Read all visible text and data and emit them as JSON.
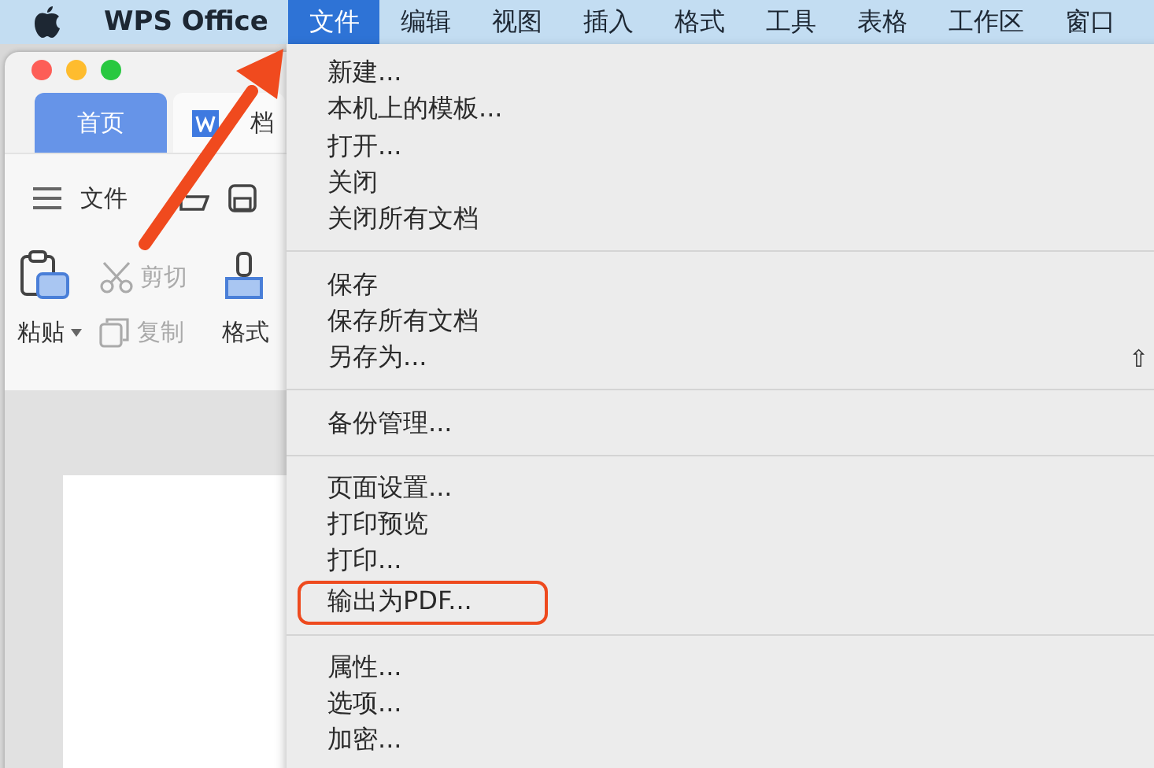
{
  "menu_bar": {
    "app_name": "WPS Office",
    "menus": [
      {
        "label": "文件",
        "selected": true
      },
      {
        "label": "编辑",
        "selected": false
      },
      {
        "label": "视图",
        "selected": false
      },
      {
        "label": "插入",
        "selected": false
      },
      {
        "label": "格式",
        "selected": false
      },
      {
        "label": "工具",
        "selected": false
      },
      {
        "label": "表格",
        "selected": false
      },
      {
        "label": "工作区",
        "selected": false
      },
      {
        "label": "窗口",
        "selected": false
      }
    ]
  },
  "window": {
    "tabs": [
      {
        "label": "首页",
        "kind": "home",
        "selected": true
      },
      {
        "label": "档",
        "kind": "document",
        "selected": false
      }
    ],
    "toolbar_menu": "文件",
    "ribbon": [
      {
        "label": "粘贴",
        "kind": "paste",
        "disabled": false
      },
      {
        "label": "剪切",
        "kind": "cut",
        "disabled": true
      },
      {
        "label": "复制",
        "kind": "copy",
        "disabled": true
      },
      {
        "label": "格式",
        "kind": "format",
        "disabled": false
      }
    ]
  },
  "file_menu": {
    "items": [
      {
        "kind": "item",
        "label": "新建...",
        "highlighted": false
      },
      {
        "kind": "item",
        "label": "本机上的模板...",
        "highlighted": false
      },
      {
        "kind": "item",
        "label": "打开...",
        "highlighted": false
      },
      {
        "kind": "item",
        "label": "关闭",
        "highlighted": false
      },
      {
        "kind": "item",
        "label": "关闭所有文档",
        "highlighted": false
      },
      {
        "kind": "separator"
      },
      {
        "kind": "item",
        "label": "保存",
        "highlighted": false
      },
      {
        "kind": "item",
        "label": "保存所有文档",
        "highlighted": false
      },
      {
        "kind": "item",
        "label": "另存为...",
        "shortcut": "⇧",
        "highlighted": false
      },
      {
        "kind": "separator"
      },
      {
        "kind": "item",
        "label": "备份管理...",
        "highlighted": false
      },
      {
        "kind": "separator"
      },
      {
        "kind": "item",
        "label": "页面设置...",
        "highlighted": false
      },
      {
        "kind": "item",
        "label": "打印预览",
        "highlighted": false
      },
      {
        "kind": "item",
        "label": "打印...",
        "highlighted": false
      },
      {
        "kind": "item",
        "label": "输出为PDF...",
        "highlighted": true
      },
      {
        "kind": "separator"
      },
      {
        "kind": "item",
        "label": "属性...",
        "highlighted": false
      },
      {
        "kind": "item",
        "label": "选项...",
        "highlighted": false
      },
      {
        "kind": "item",
        "label": "加密...",
        "highlighted": false
      }
    ]
  }
}
